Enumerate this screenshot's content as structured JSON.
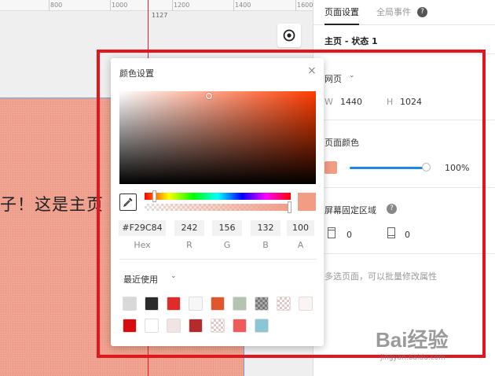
{
  "ruler": {
    "ticks": [
      "800",
      "1000",
      "1200",
      "1400",
      "1600"
    ],
    "guide_label": "1127"
  },
  "canvas": {
    "page_text": "子！这是主页"
  },
  "panel": {
    "tabs": [
      {
        "label": "页面设置",
        "active": true
      },
      {
        "label": "全局事件",
        "active": false
      }
    ],
    "help_glyph": "?",
    "state_title": "主页 - 状态 1",
    "device_label": "网页",
    "width_label": "W",
    "width_value": "1440",
    "height_label": "H",
    "height_value": "1024",
    "page_color_label": "页面颜色",
    "page_color": "#f29c84",
    "opacity_value": "100%",
    "opacity_fraction": 1.0,
    "fixed_area_label": "屏幕固定区域",
    "fixed_top_value": "0",
    "fixed_bottom_value": "0",
    "multi_select_hint": "多选页面，可以批量修改属性"
  },
  "color_picker": {
    "title": "颜色设置",
    "close_glyph": "×",
    "hex_value": "#F29C84",
    "r_value": "242",
    "g_value": "156",
    "b_value": "132",
    "a_value": "100",
    "hex_label": "Hex",
    "r_label": "R",
    "g_label": "G",
    "b_label": "B",
    "a_label": "A",
    "recent_label": "最近使用",
    "recent_colors": [
      [
        "#d9d9d9",
        "#2b2b2b",
        "#e02b2b",
        "#f7f7f7",
        "#e0572b",
        "#b5c4b1",
        "transparent-dark",
        "transparent-pink",
        "#faf4f4"
      ],
      [
        "#d80c0c",
        "#ffffff",
        "#f1e4e4",
        "#b32b2b",
        "transparent-pink",
        "#f05a5a",
        "#89c7d6"
      ]
    ]
  },
  "watermark": {
    "logo": "Bai经验",
    "url": "jingyan.baidu.com"
  },
  "colors": {
    "highlight": "#e4161d",
    "accent": "#1e88e5",
    "guide": "#e0202b"
  }
}
